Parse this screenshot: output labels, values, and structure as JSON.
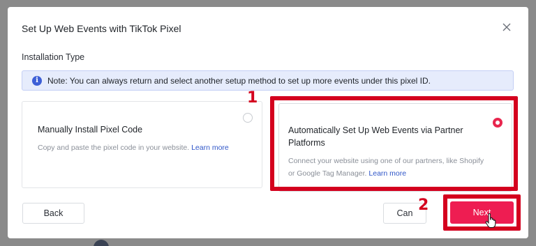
{
  "modal": {
    "title": "Set Up Web Events with TikTok Pixel",
    "section_label": "Installation Type",
    "note": "Note: You can always return and select another setup method to set up more events under this pixel ID."
  },
  "options": [
    {
      "title": "Manually Install Pixel Code",
      "description": "Copy and paste the pixel code in your website.",
      "link": "Learn more",
      "selected": false
    },
    {
      "title_line1": "Automatically Set Up Web Events via Partner",
      "title_line2": "Platforms",
      "description_line1": "Connect your website using one of our partners, like Shopify",
      "description_line2": "or Google Tag Manager.",
      "link": "Learn more",
      "selected": true
    }
  ],
  "buttons": {
    "back": "Back",
    "cancel": "Can",
    "next": "Next"
  },
  "annotations": {
    "step1": "1",
    "step2": "2"
  },
  "colors": {
    "accent": "#ee1d52",
    "highlight": "#d4001e",
    "note_bg": "#e6ecfc",
    "link": "#2f56c8"
  },
  "icons": [
    "close-icon",
    "info-icon",
    "cursor-hand-icon"
  ]
}
